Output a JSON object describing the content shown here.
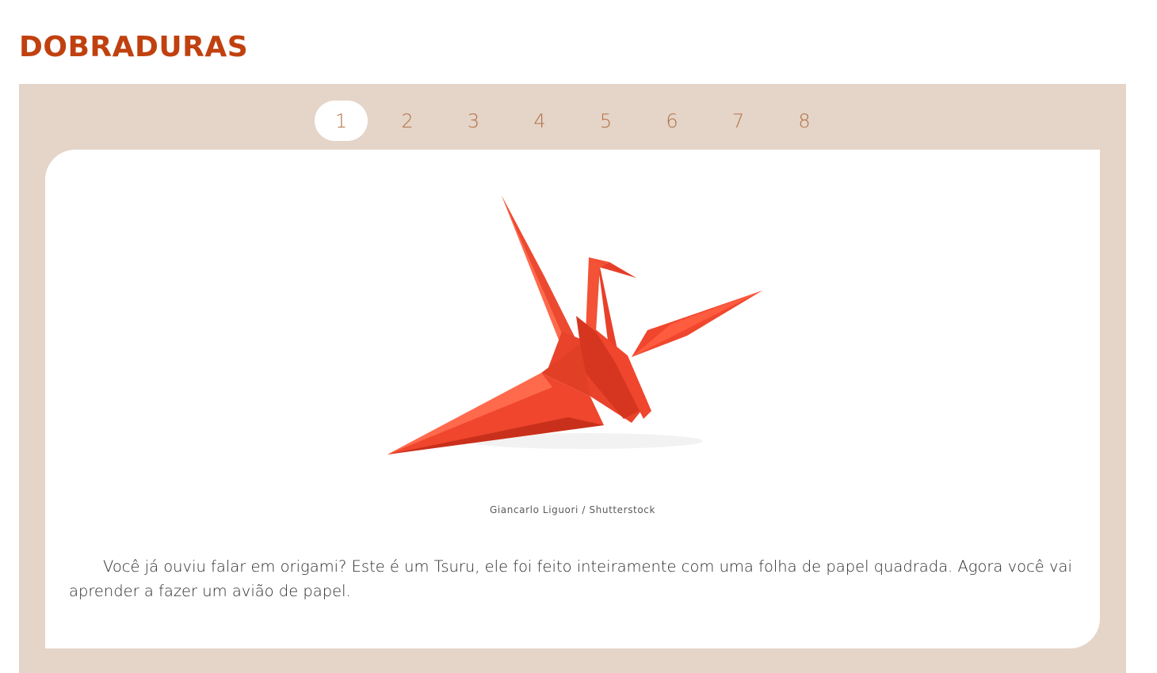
{
  "header": {
    "title": "DOBRADURAS"
  },
  "pager": {
    "pages": [
      "1",
      "2",
      "3",
      "4",
      "5",
      "6",
      "7",
      "8"
    ],
    "active_index": 0
  },
  "slide": {
    "image": {
      "subject": "red origami crane (tsuru)",
      "colors": {
        "paper_main": "#f0462e",
        "paper_dark": "#c9301b",
        "paper_light": "#ff6a4c"
      }
    },
    "credit": "Giancarlo Liguori / Shutterstock",
    "text": "Você já ouviu falar em origami? Este é um Tsuru, ele foi feito inteiramente com uma folha de papel quadrada. Agora você vai aprender a fazer um avião de papel."
  },
  "colors": {
    "title": "#c0410f",
    "panel_background": "#e5d4c8",
    "pager_text": "#b27448",
    "card_background": "#ffffff"
  }
}
